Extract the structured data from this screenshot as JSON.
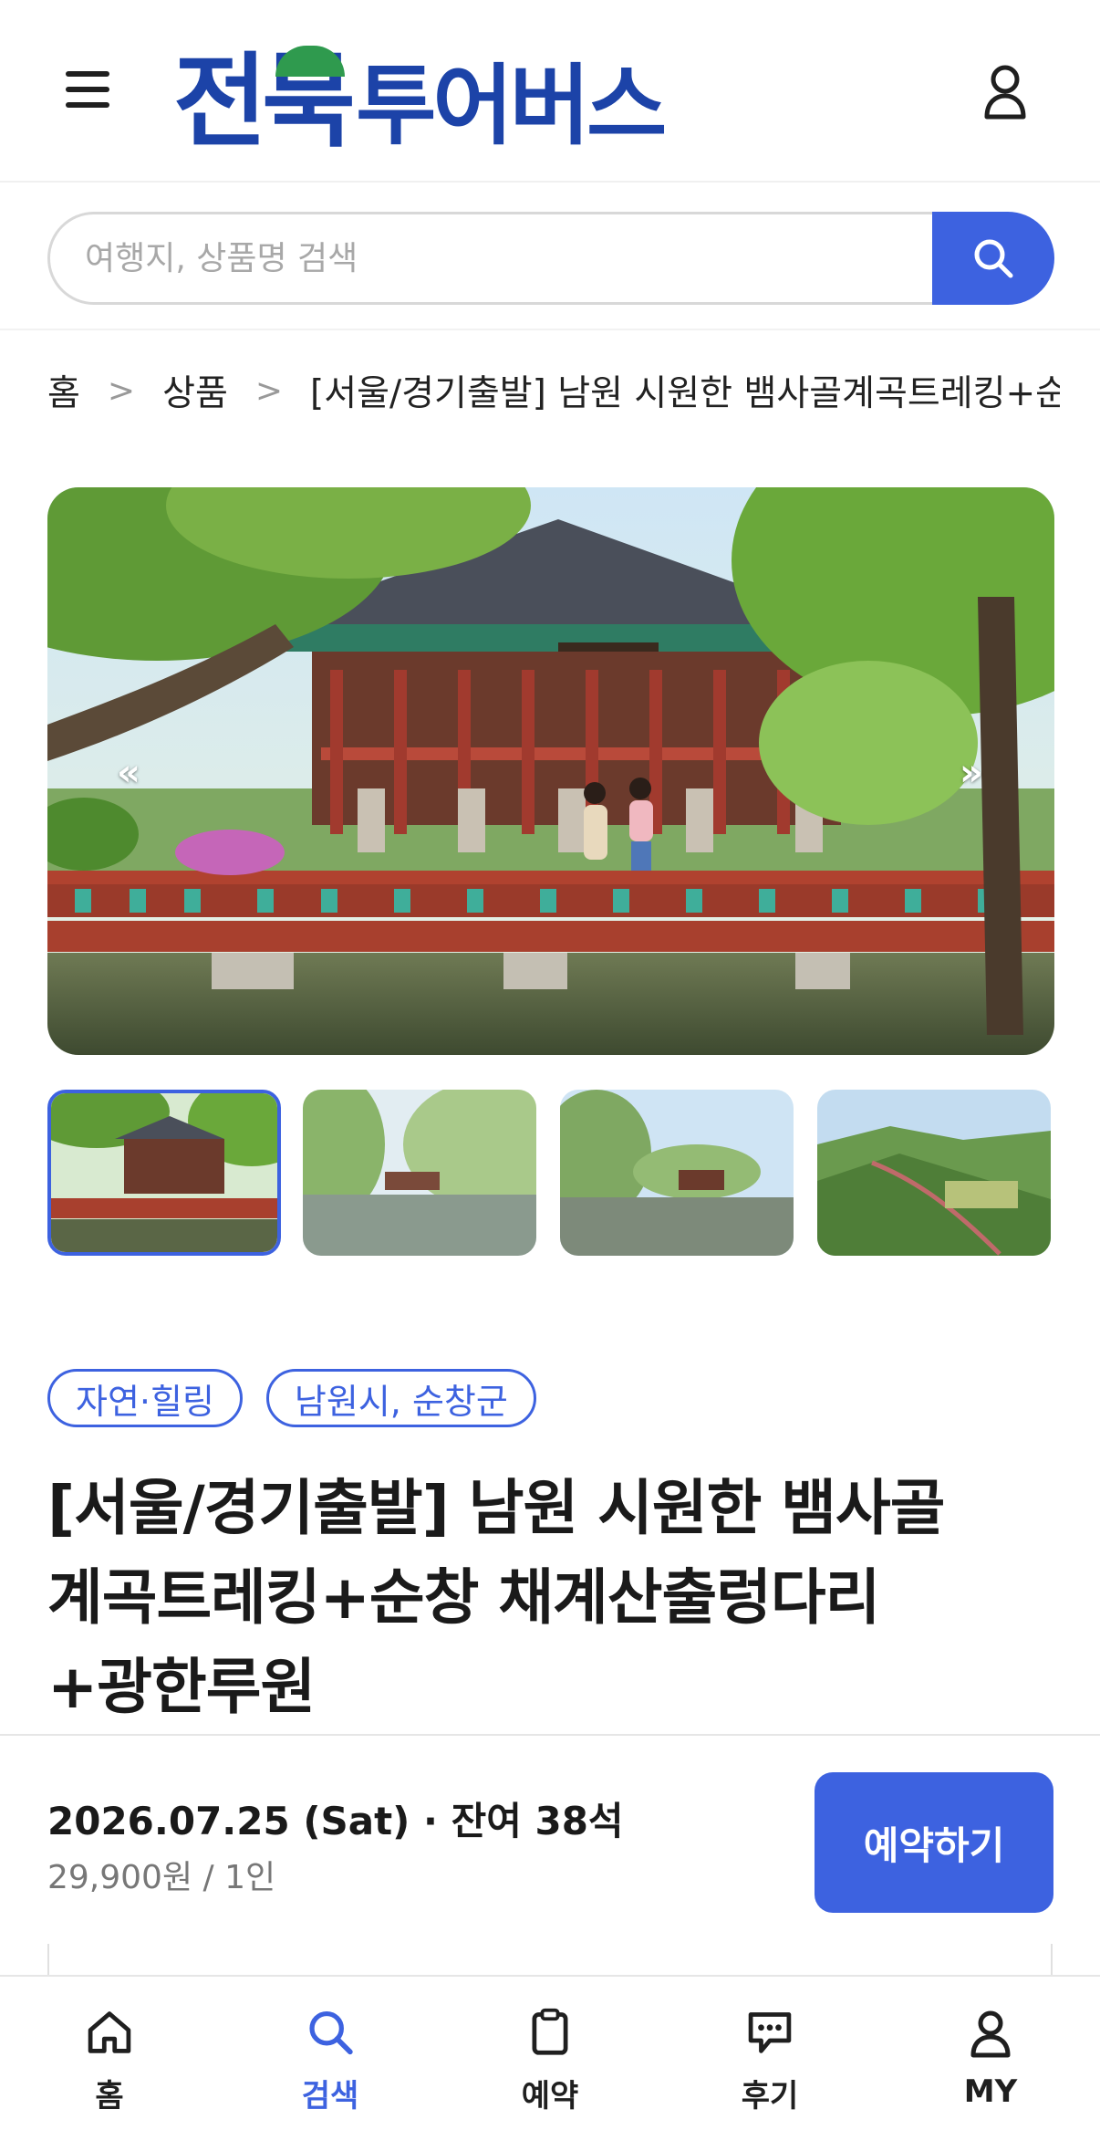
{
  "header": {
    "logo_main": "전북",
    "logo_sub": "투어버스"
  },
  "search": {
    "placeholder": "여행지, 상품명 검색"
  },
  "breadcrumb": {
    "home": "홈",
    "category": "상품",
    "current": "[서울/경기출발] 남원 시원한 뱀사골계곡트레킹+순창 채계산출렁다리+광한루원"
  },
  "gallery": {
    "prev": "«",
    "next": "»",
    "thumbnail_count": 4,
    "active_index": 0
  },
  "product": {
    "tags": [
      "자연·힐링",
      "남원시, 순창군"
    ],
    "title_lines": [
      "[서울/경기출발] 남원 시원한 뱀사골",
      "계곡트레킹+순창 채계산출렁다리",
      "+광한루원"
    ]
  },
  "booking": {
    "date_info": "2026.07.25 (Sat) · 잔여 38석",
    "price": "29,900원 / 1인",
    "reserve_label": "예약하기"
  },
  "bottom_nav": {
    "items": [
      {
        "label": "홈",
        "icon": "home-icon"
      },
      {
        "label": "검색",
        "icon": "search-icon"
      },
      {
        "label": "예약",
        "icon": "clipboard-icon"
      },
      {
        "label": "후기",
        "icon": "chat-icon"
      },
      {
        "label": "MY",
        "icon": "user-icon"
      }
    ],
    "active": "검색"
  },
  "colors": {
    "accent": "#3d62e0",
    "logo_blue": "#1c43a8",
    "logo_green": "#2f9a4e"
  }
}
